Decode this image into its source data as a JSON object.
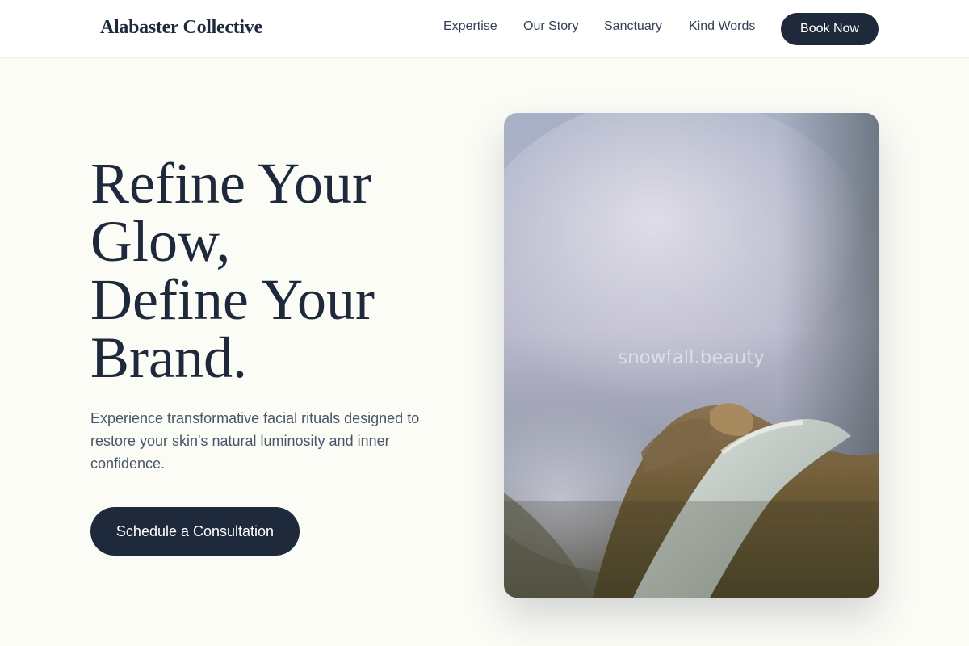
{
  "header": {
    "brand": "Alabaster Collective",
    "nav": [
      {
        "label": "Expertise"
      },
      {
        "label": "Our Story"
      },
      {
        "label": "Sanctuary"
      },
      {
        "label": "Kind Words"
      }
    ],
    "cta": "Book Now"
  },
  "hero": {
    "title_lines": [
      "Refine Your",
      "Glow,",
      "Define Your",
      "Brand."
    ],
    "description": "Experience transformative facial rituals designed to restore your skin's natural luminosity and inner confidence.",
    "cta": "Schedule a Consultation",
    "image_watermark": "snowfall.beauty"
  },
  "colors": {
    "background": "#fcfcf6",
    "header_background": "#ffffff",
    "primary": "#1e293b",
    "text": "#1e293b",
    "muted_text": "#475569"
  }
}
